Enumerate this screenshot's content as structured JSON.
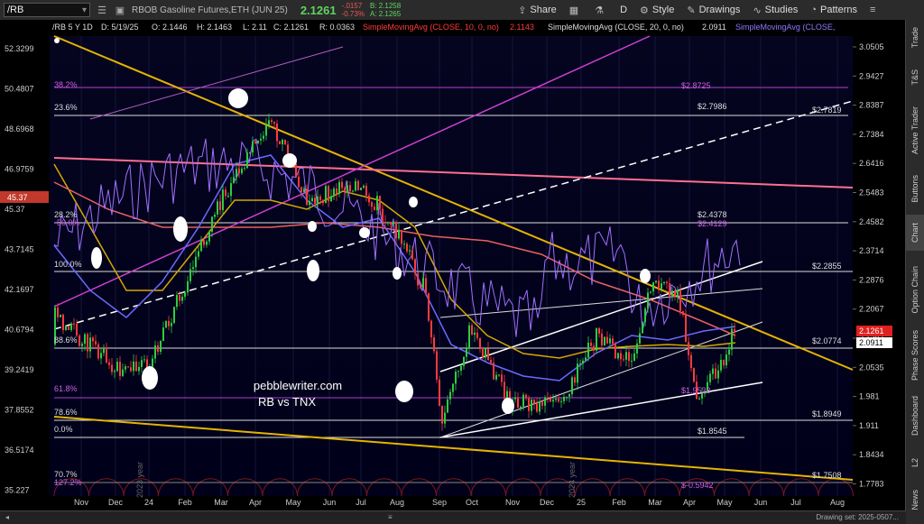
{
  "toolbar": {
    "symbol": "/RB",
    "instrument": "RBOB Gasoline Futures,ETH (JUN 25)",
    "last": "2.1261",
    "change": "-.0157",
    "change_pct": "-0.73%",
    "bid": "B: 2.1258",
    "ask": "A: 2.1265",
    "share_label": "Share",
    "aggregation_label": "D",
    "style_label": "Style",
    "drawings_label": "Drawings",
    "studies_label": "Studies",
    "patterns_label": "Patterns"
  },
  "header": {
    "chart_id": "/RB 5 Y 1D",
    "date": "D: 5/19/25",
    "open": "O: 2.1446",
    "high": "H: 2.1463",
    "low": "L: 2.11",
    "close": "C: 2.1261",
    "range": "R: 0.0363",
    "sma10": "SimpleMovingAvg (CLOSE, 10, 0, no)",
    "sma10_val": "2.1143",
    "sma20": "SimpleMovingAvg (CLOSE, 20, 0, no)",
    "sma20_val": "2.0911",
    "sma_more": "SimpleMovingAvg (CLOSE,"
  },
  "sidebar": {
    "tabs": [
      "Trade",
      "T&S",
      "Active Trader",
      "Buttons",
      "Chart",
      "Option Chain",
      "Phase Scores",
      "Dashboard",
      "L2",
      "News"
    ],
    "active": "Chart"
  },
  "watermark": {
    "line1": "pebblewriter.com",
    "line2": "RB   vs   TNX"
  },
  "year_labels": {
    "y2023": "2023 year",
    "y2024": "2024 year"
  },
  "statusbar": {
    "text": "Drawing set: 2025-0507..."
  },
  "axis": {
    "left_ticks": [
      "52.3299",
      "50.4807",
      "48.6968",
      "46.9759",
      "45.37",
      "43.7145",
      "42.1697",
      "40.6794",
      "39.2419",
      "37.8552",
      "36.5174",
      "35.227"
    ],
    "right_ticks": [
      "3.0505",
      "2.9427",
      "2.8387",
      "2.7384",
      "2.6416",
      "2.5483",
      "2.4582",
      "2.3714",
      "2.2876",
      "2.2067",
      "2.1287",
      "2.0535",
      "1.981",
      "1.911",
      "1.8434",
      "1.7783"
    ],
    "x_ticks": [
      "Nov",
      "Dec",
      "24",
      "Feb",
      "Mar",
      "Apr",
      "May",
      "Jun",
      "Jul",
      "Aug",
      "Sep",
      "Oct",
      "Nov",
      "Dec",
      "25",
      "Feb",
      "Mar",
      "Apr",
      "May",
      "Jun",
      "Jul",
      "Aug"
    ],
    "last_price_tag": "2.1261",
    "sma_tag": "2.0911"
  },
  "fib_left": [
    "38.2%",
    "23.6%",
    "28.2%",
    "100.0%",
    "88.6%",
    "61.8%",
    "78.6%",
    "0.0%",
    "70.7%",
    "127.2%"
  ],
  "fib_left_extra": [
    "-50.0%"
  ],
  "fib_right": [
    "$2.8725",
    "$2.7986",
    "$2.4378",
    "$2.4129",
    "$2.2855",
    "$2.0774",
    "$1.9533",
    "$1.8949",
    "$1.8545",
    "$1.7508",
    "$-0.5942",
    "$2.7819"
  ],
  "colors": {
    "up": "#2ecc40",
    "down": "#ff3b3b",
    "gold": "#e5b400",
    "pink": "#ff6f8f",
    "violet": "#a070ff",
    "magenta": "#d040d0",
    "blue": "#6a6aff",
    "chart_bg": "#000020"
  }
}
